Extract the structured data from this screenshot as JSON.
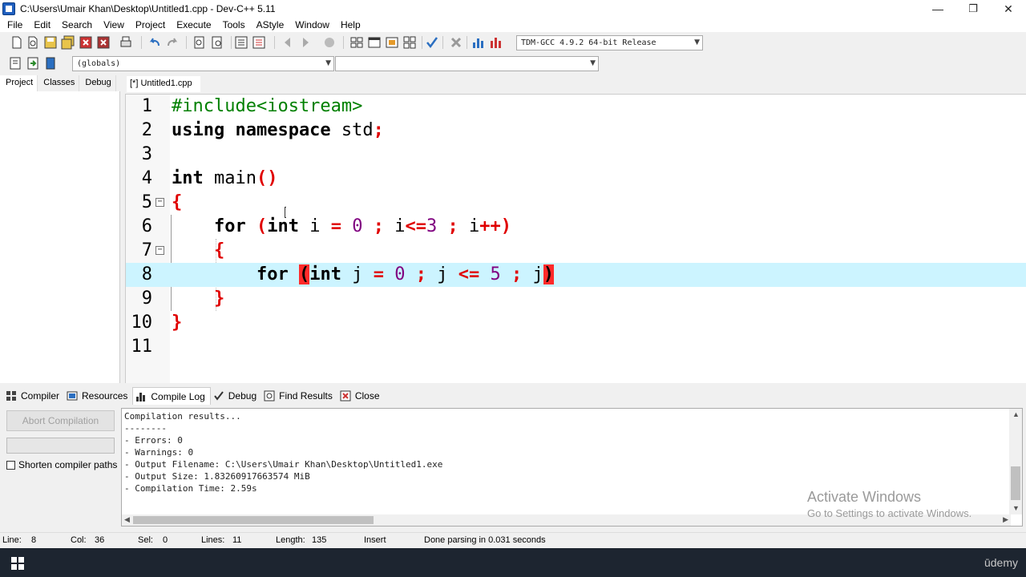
{
  "window": {
    "title": "C:\\Users\\Umair Khan\\Desktop\\Untitled1.cpp - Dev-C++ 5.11",
    "minimize": "—",
    "restore": "❐",
    "close": "✕"
  },
  "menu": [
    "File",
    "Edit",
    "Search",
    "View",
    "Project",
    "Execute",
    "Tools",
    "AStyle",
    "Window",
    "Help"
  ],
  "toolbar": {
    "compiler_select": "TDM-GCC 4.9.2 64-bit Release",
    "scope_select": "(globals)",
    "function_select": ""
  },
  "left_panel": {
    "tabs": [
      "Project",
      "Classes",
      "Debug"
    ],
    "active_tab": "Project"
  },
  "editor": {
    "tab_label": "[*] Untitled1.cpp",
    "current_line": 8
  },
  "bottom": {
    "tabs": [
      {
        "label": "Compiler",
        "icon": "compiler-grid-icon"
      },
      {
        "label": "Resources",
        "icon": "resources-icon"
      },
      {
        "label": "Compile Log",
        "icon": "compile-log-chart-icon"
      },
      {
        "label": "Debug",
        "icon": "debug-check-icon"
      },
      {
        "label": "Find Results",
        "icon": "find-results-icon"
      },
      {
        "label": "Close",
        "icon": "close-panel-icon"
      }
    ],
    "abort_label": "Abort Compilation",
    "shorten_label": "Shorten compiler paths",
    "log_lines": [
      "Compilation results...",
      "--------",
      "- Errors: 0",
      "- Warnings: 0",
      "- Output Filename: C:\\Users\\Umair Khan\\Desktop\\Untitled1.exe",
      "- Output Size: 1.83260917663574 MiB",
      "- Compilation Time: 2.59s"
    ]
  },
  "watermark": {
    "title": "Activate Windows",
    "subtitle": "Go to Settings to activate Windows."
  },
  "status": {
    "line_label": "Line:",
    "line_value": "8",
    "col_label": "Col:",
    "col_value": "36",
    "sel_label": "Sel:",
    "sel_value": "0",
    "lines_label": "Lines:",
    "lines_value": "11",
    "length_label": "Length:",
    "length_value": "135",
    "mode": "Insert",
    "message": "Done parsing in 0.031 seconds"
  },
  "taskbar": {
    "brand": "ūdemy"
  }
}
